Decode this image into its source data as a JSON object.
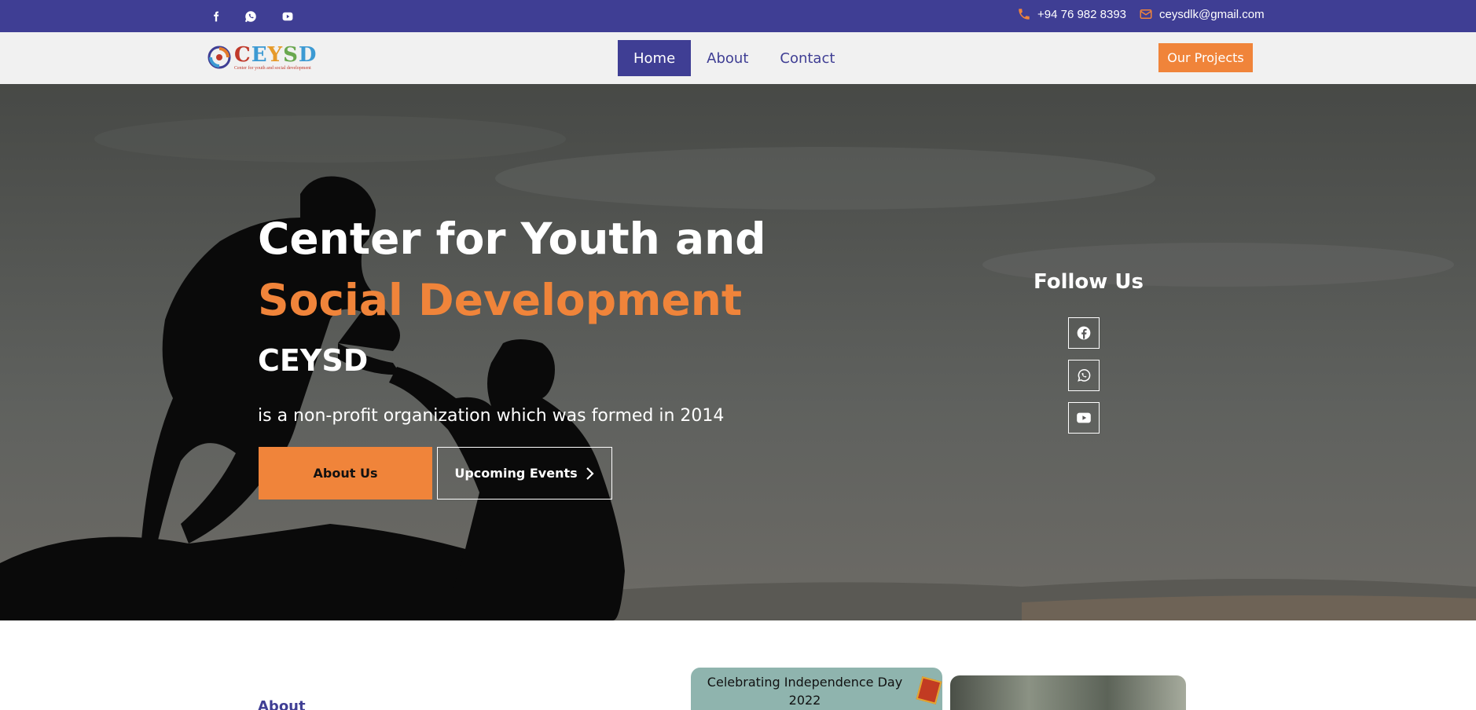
{
  "topbar": {
    "social_icons": [
      "facebook-icon",
      "whatsapp-icon",
      "youtube-icon"
    ],
    "phone": "+94 76 982 8393",
    "email": "ceysdlk@gmail.com"
  },
  "logo": {
    "letters": [
      "C",
      "E",
      "Y",
      "S",
      "D"
    ],
    "subtitle": "Center for youth and social development"
  },
  "nav": {
    "items": [
      {
        "label": "Home",
        "active": true
      },
      {
        "label": "About",
        "active": false
      },
      {
        "label": "Contact",
        "active": false
      }
    ],
    "cta": "Our Projects"
  },
  "hero": {
    "title_line1": "Center for Youth and",
    "title_line2": "Social Development",
    "abbr": "CEYSD",
    "tagline": "is a non-profit organization which was formed in 2014",
    "btn_about": "About Us",
    "btn_events": "Upcoming Events",
    "follow_title": "Follow Us",
    "follow_icons": [
      "facebook-icon",
      "whatsapp-icon",
      "youtube-icon"
    ]
  },
  "below": {
    "about_label": "About",
    "card1_caption_line1": "Celebrating Independence Day",
    "card1_caption_line2": "2022"
  },
  "colors": {
    "brand_purple": "#3f3e94",
    "accent_orange": "#f0843a",
    "nav_bg": "#f1f1f1"
  }
}
